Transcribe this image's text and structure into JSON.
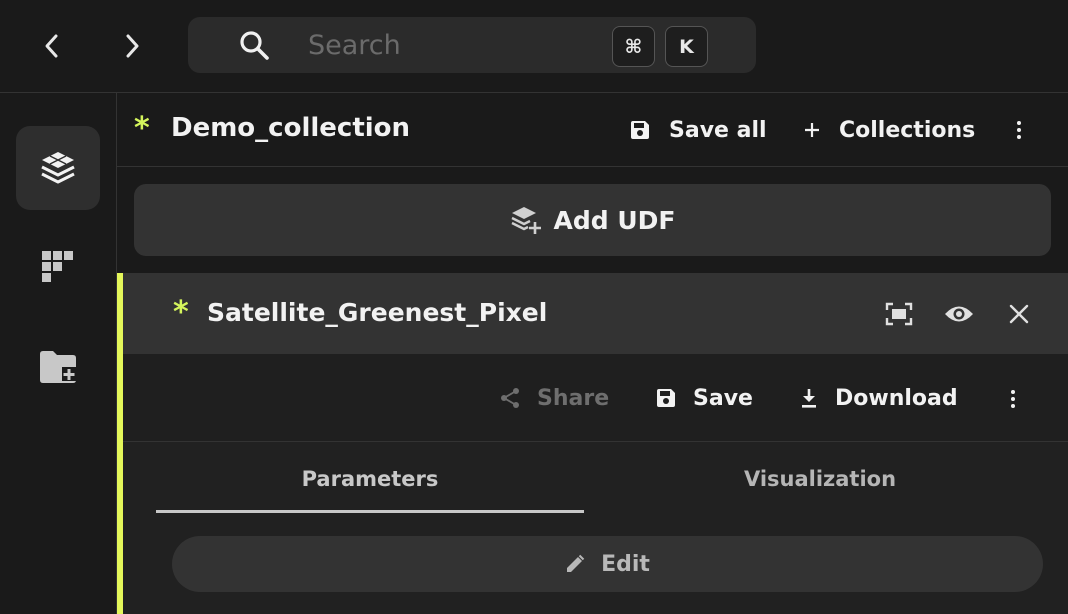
{
  "topbar": {
    "back_icon": "chevron-left-icon",
    "forward_icon": "chevron-right-icon",
    "search": {
      "placeholder": "Search",
      "value": "",
      "shortcut_keys": [
        "⌘",
        "K"
      ]
    }
  },
  "rail": {
    "items": [
      {
        "icon": "layers-icon",
        "active": true
      },
      {
        "icon": "grid-blocks-icon",
        "active": false
      },
      {
        "icon": "folder-add-icon",
        "active": false
      }
    ]
  },
  "collection": {
    "marker": "*",
    "title": "Demo_collection",
    "save_all_label": "Save all",
    "collections_label": "Collections",
    "add_udf_label": "Add UDF"
  },
  "udf": {
    "marker": "*",
    "title": "Satellite_Greenest_Pixel",
    "toolbar": {
      "share_label": "Share",
      "save_label": "Save",
      "download_label": "Download"
    },
    "tabs": [
      {
        "label": "Parameters",
        "active": true
      },
      {
        "label": "Visualization",
        "active": false
      }
    ],
    "edit_label": "Edit"
  },
  "colors": {
    "accent": "#d4f55c",
    "background": "#1a1a1a",
    "panel": "#333333"
  }
}
